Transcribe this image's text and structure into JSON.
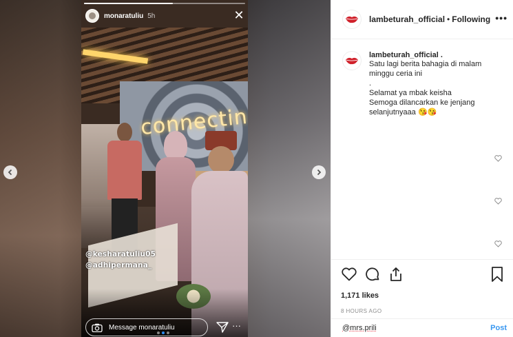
{
  "story": {
    "username": "monaratuliu",
    "time": "5h",
    "sign_text": "connectin",
    "mentions": [
      "@kesharatuliu05",
      "@adhipermana_"
    ],
    "reply_placeholder": "Message monaratuliu",
    "progress": 0.55,
    "icons": {
      "close": "close-icon",
      "camera": "camera-icon",
      "send": "send-icon",
      "more": "more-icon",
      "prev": "chevron-left-icon",
      "next": "chevron-right-icon"
    }
  },
  "post": {
    "username": "lambeturah_official",
    "separator": "•",
    "follow_status": "Following",
    "more": "•••",
    "caption": {
      "username": "lambeturah_official .",
      "lines": [
        "Satu lagi berita bahagia di malam",
        "minggu ceria ini",
        ".",
        "Selamat ya mbak keisha",
        "Semoga dilancarkan ke jenjang",
        "selanjutnyaaa 😘😘"
      ]
    },
    "likes": "1,171 likes",
    "posted": "8 HOURS AGO",
    "comment_input": "@mrs.prili",
    "post_button": "Post"
  },
  "colors": {
    "link_blue": "#3897f0",
    "text": "#262626",
    "muted": "#8e8e8e",
    "lips_red": "#d0212b"
  }
}
